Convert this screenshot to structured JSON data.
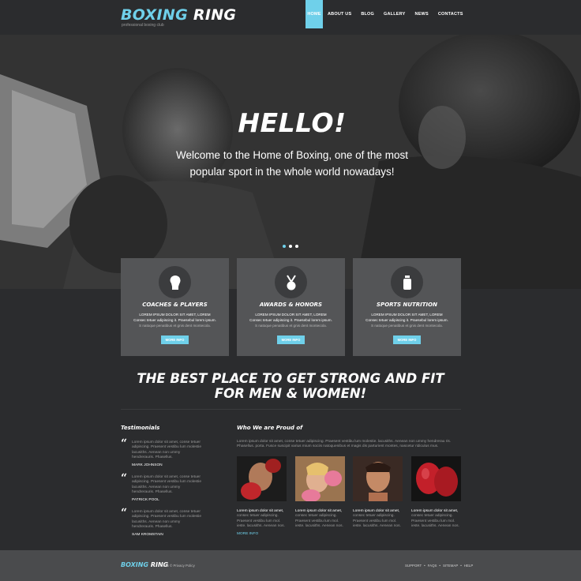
{
  "brand": {
    "word1": "BOXING",
    "word2": "RING",
    "tagline": "professional boxing club"
  },
  "nav": [
    {
      "label": "HOME",
      "active": true
    },
    {
      "label": "ABOUT US"
    },
    {
      "label": "BLOG"
    },
    {
      "label": "GALLERY"
    },
    {
      "label": "NEWS"
    },
    {
      "label": "CONTACTS"
    }
  ],
  "hero": {
    "title": "HELLO!",
    "subtitle": "Welcome to the Home of Boxing, one of the most popular sport in the whole world nowadays!",
    "slides": 3,
    "active_slide": 1
  },
  "features": [
    {
      "icon": "boxing-glove-icon",
      "title": "COACHES & PLAYERS",
      "line1": "LOREM IPSUM DOLOR SIT AMET, LOREM",
      "line2": "Consec tetuer adipiscing it. Praesebul lorem ipsum.",
      "line3": "S natoque penatibus et gnis dent montecola.",
      "button": "MORE INFO"
    },
    {
      "icon": "medal-icon",
      "title": "AWARDS & HONORS",
      "line1": "LOREM IPSUM DOLOR SIT AMET, LOREM",
      "line2": "Consec tetuer adipiscing it. Praesebul lorem ipsum.",
      "line3": "S natoque penatibus et gnis dent montecola.",
      "button": "MORE INFO"
    },
    {
      "icon": "supplement-bottle-icon",
      "title": "SPORTS NUTRITION",
      "line1": "LOREM IPSUM DOLOR SIT AMET, LOREM",
      "line2": "Consec tetuer adipiscing it. Praesebul lorem ipsum.",
      "line3": "S natoque penatibus et gnis dent montecola.",
      "button": "MORE INFO"
    }
  ],
  "headline": {
    "line1": "THE BEST PLACE TO GET STRONG AND FIT",
    "line2": "FOR MEN & WOMEN!"
  },
  "testimonials": {
    "title": "Testimonials",
    "items": [
      {
        "text": "Lorem ipsum dolor sit amet, conse tetuer adipiscing. Praesent vestibu lum molestie lacusiths. Aenean non ummy hendrerauris. Phasellus.",
        "name": "MARK JOHNSON"
      },
      {
        "text": "Lorem ipsum dolor sit amet, conse tetuer adipiscing. Praesent vestibu lum molestie lacusiths. Aenean non ummy hendrerauris. Phasellus.",
        "name": "PATRICK POOL"
      },
      {
        "text": "Lorem ipsum dolor sit amet, conse tetuer adipiscing. Praesent vestibu lum molestie lacusiths. Aenean non ummy hendrerauris. Phasellus.",
        "name": "SAM KROMSTAIN"
      }
    ]
  },
  "proud": {
    "title": "Who We are Proud of",
    "intro": "Lorem ipsum dolor sit amet, conse tetuer adipiscing. Praesent vestibu lum molestie. lacusiths. Aenean non ummy hendrerau ris. Phasellus. porta. Fusce suscipit varius mium sociis natoquenibus et magis dis parturient montes, nascetur ridiculus mus.",
    "people": [
      {
        "caption_strong": "Lorem ipsum dolor sit amet,",
        "caption": "consec tetuer adipiscing. Praesent vestibu lum mol. ieste. lacusiths. Aenean nos."
      },
      {
        "caption_strong": "Lorem ipsum dolor sit amet,",
        "caption": "consec tetuer adipiscing. Praesent vestibu lum mol. ieste. lacusiths. Aenean nos."
      },
      {
        "caption_strong": "Lorem ipsum dolor sit amet,",
        "caption": "consec tetuer adipiscing. Praesent vestibu lum mol. ieste. lacusiths. Aenean nos."
      },
      {
        "caption_strong": "Lorem ipsum dolor sit amet,",
        "caption": "consec tetuer adipiscing. Praesent vestibu lum mol. ieste. lacusiths. Aenean nos."
      }
    ],
    "more": "MORE INFO"
  },
  "footer": {
    "logo1": "BOXING",
    "logo2": "RING",
    "copyright": "2015 © Privacy Policy",
    "links": [
      "SUPPORT",
      "FAQS",
      "SITEMAP",
      "HELP"
    ]
  },
  "colors": {
    "accent": "#6fd0ea",
    "background": "#2b2c2e",
    "card": "#545557",
    "footer": "#4a4b4d"
  }
}
